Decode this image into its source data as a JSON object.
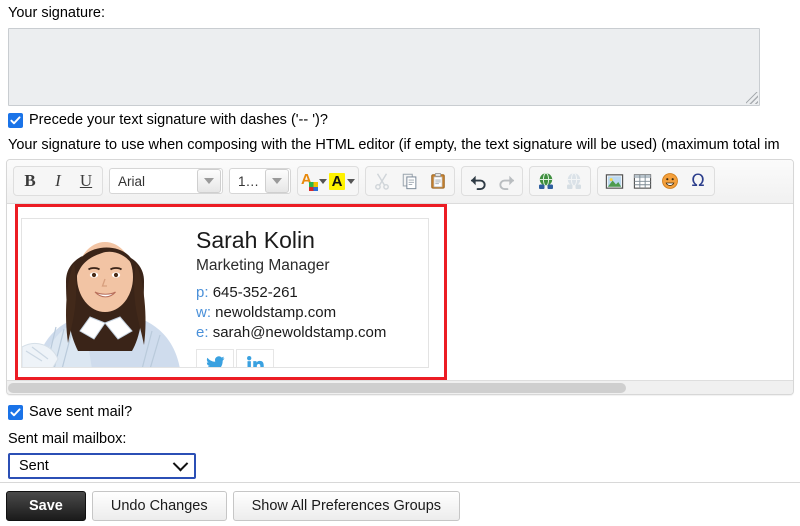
{
  "form": {
    "signature_label": "Your signature:",
    "signature_value": "",
    "signature_placeholder": "",
    "dashes_checkbox_label": "Precede your text signature with dashes ('-- ')?",
    "html_signature_label": "Your signature to use when composing with the HTML editor (if empty, the text signature will be used) (maximum total im",
    "save_sent_mail_label": "Save sent mail?",
    "sent_mailbox_label": "Sent mail mailbox:",
    "sent_mailbox_value": "Sent"
  },
  "toolbar": {
    "bold": "B",
    "italic": "I",
    "underline": "U",
    "font_family_value": "Arial",
    "font_size_value": "1…",
    "text_color_glyph": "A",
    "highlight_glyph": "A"
  },
  "signature_card": {
    "name": "Sarah Kolin",
    "title": "Marketing Manager",
    "phone_key": "p:",
    "phone_value": "645-352-261",
    "web_key": "w:",
    "web_value": "newoldstamp.com",
    "email_key": "e:",
    "email_value": "sarah@newoldstamp.com"
  },
  "footer": {
    "save_label": "Save",
    "undo_label": "Undo Changes",
    "show_all_label": "Show All Preferences Groups"
  },
  "colors": {
    "accent_blue": "#1a73e8",
    "annotation_red": "#ec1c24",
    "select_border": "#2b4fb5",
    "link_blue": "#4a90d9",
    "highlight_yellow": "#fff200"
  }
}
